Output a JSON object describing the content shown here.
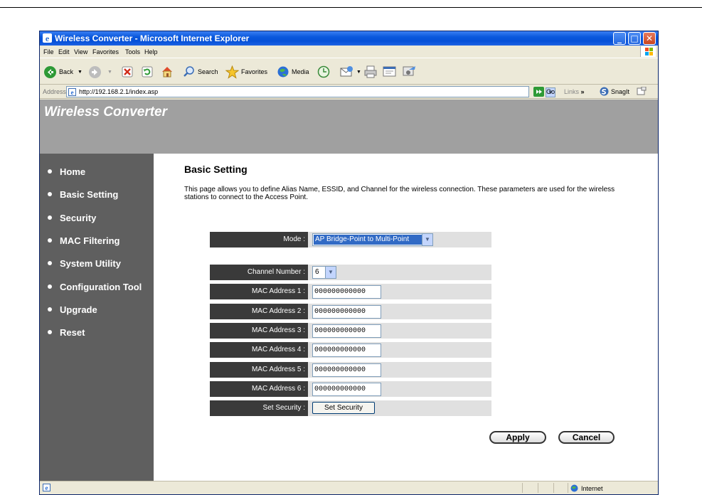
{
  "window": {
    "title": "Wireless Converter - Microsoft Internet Explorer",
    "controls": {
      "minimize": "_",
      "maximize": "□",
      "close": "✕"
    }
  },
  "menu": [
    "File",
    "Edit",
    "View",
    "Favorites",
    "Tools",
    "Help"
  ],
  "toolbar": {
    "back": "Back",
    "search": "Search",
    "favorites": "Favorites",
    "media": "Media"
  },
  "address": {
    "label": "Address",
    "url": "http://192.168.2.1/index.asp",
    "go": "Go",
    "links": "Links",
    "snagit": "SnagIt"
  },
  "banner": {
    "brand": "Wireless Converter"
  },
  "sidebar": {
    "items": [
      {
        "label": "Home"
      },
      {
        "label": "Basic Setting"
      },
      {
        "label": "Security"
      },
      {
        "label": "MAC Filtering"
      },
      {
        "label": "System Utility"
      },
      {
        "label": "Configuration Tool"
      },
      {
        "label": "Upgrade"
      },
      {
        "label": "Reset"
      }
    ]
  },
  "page": {
    "title": "Basic Setting",
    "description": "This page allows you to define Alias Name, ESSID, and Channel for the wireless connection. These parameters are used for the wireless stations to connect to the Access Point."
  },
  "form": {
    "mode": {
      "label": "Mode :",
      "value": "AP Bridge-Point to Multi-Point"
    },
    "channel": {
      "label": "Channel Number :",
      "value": "6"
    },
    "mac_addresses": [
      {
        "label": "MAC Address 1 :",
        "value": "000000000000"
      },
      {
        "label": "MAC Address 2 :",
        "value": "000000000000"
      },
      {
        "label": "MAC Address 3 :",
        "value": "000000000000"
      },
      {
        "label": "MAC Address 4 :",
        "value": "000000000000"
      },
      {
        "label": "MAC Address 5 :",
        "value": "000000000000"
      },
      {
        "label": "MAC Address 6 :",
        "value": "000000000000"
      }
    ],
    "security": {
      "label": "Set Security :",
      "button": "Set Security"
    },
    "apply": "Apply",
    "cancel": "Cancel"
  },
  "status": {
    "zone": "Internet"
  },
  "colors": {
    "banner": "#a0a0a0",
    "sidebar": "#5f5f5f",
    "label_bg": "#3a3a3a",
    "title_bar": "#0a58dc"
  }
}
